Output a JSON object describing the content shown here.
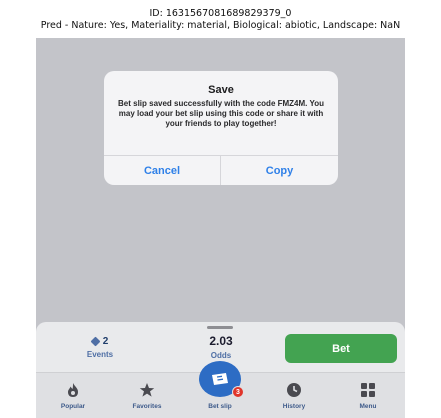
{
  "caption": {
    "line1": "ID: 1631567081689829379_0",
    "line2": "Pred - Nature: Yes, Materiality: material, Biological: abiotic, Landscape: NaN"
  },
  "alert": {
    "title": "Save",
    "message": "Bet slip saved successfully with the code FMZ4M. You may load your bet slip using this code or share it with your friends to play together!",
    "cancel_label": "Cancel",
    "copy_label": "Copy"
  },
  "betslip_bar": {
    "events_count": "2",
    "events_label": "Events",
    "odds_value": "2.03",
    "odds_label": "Odds",
    "bet_label": "Bet"
  },
  "tabbar": {
    "items": [
      {
        "label": "Popular",
        "icon": "flame-icon"
      },
      {
        "label": "Favorites",
        "icon": "star-icon"
      },
      {
        "label": "Bet slip",
        "icon": "ticket-icon"
      },
      {
        "label": "History",
        "icon": "clock-icon"
      },
      {
        "label": "Menu",
        "icon": "grid-icon"
      }
    ],
    "betslip_badge": "3"
  },
  "colors": {
    "overlay": "#c3c4c9",
    "link_blue": "#2f80e8",
    "bet_green": "#43a351",
    "navy": "#1f3d6b",
    "badge_red": "#e0352b"
  }
}
